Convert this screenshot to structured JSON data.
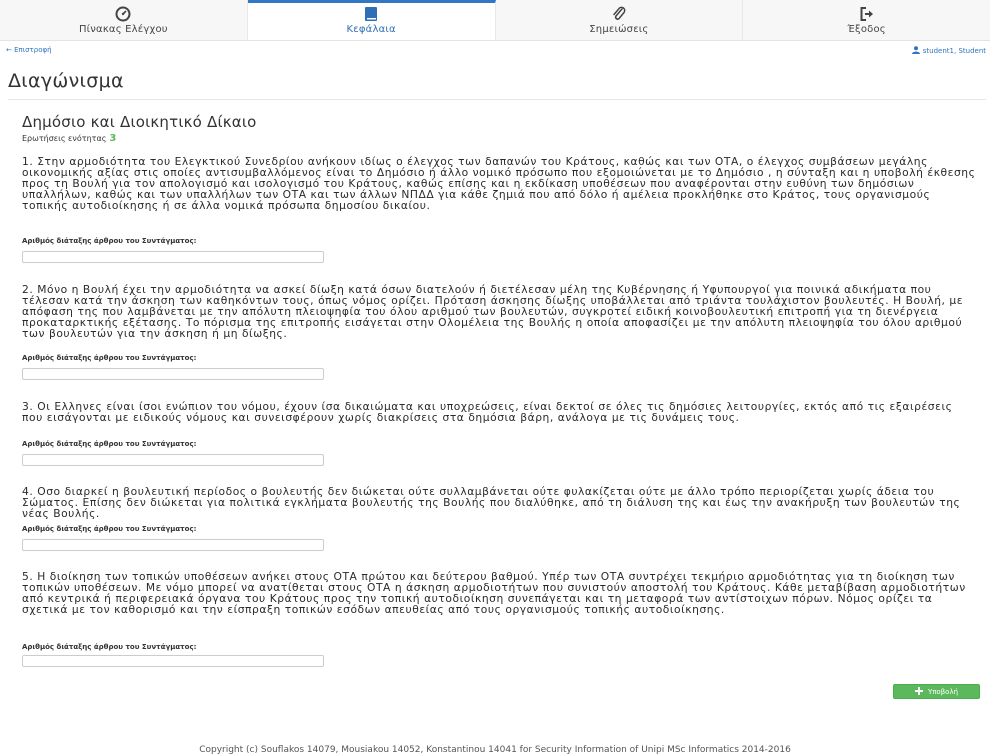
{
  "nav": {
    "tabs": [
      {
        "label": "Πίνακας Ελέγχου",
        "icon": "dashboard-icon"
      },
      {
        "label": "Κεφάλαια",
        "icon": "book-icon",
        "active": true
      },
      {
        "label": "Σημειώσεις",
        "icon": "paperclip-icon"
      },
      {
        "label": "Έξοδος",
        "icon": "sign-out-icon"
      }
    ]
  },
  "subbar": {
    "back_label": "← Επιστροφή",
    "user_label": "student1, Student"
  },
  "page": {
    "title": "Διαγώνισμα"
  },
  "section": {
    "title": "Δημόσιο και Διοικητικό Δίκαιο",
    "count_label": "Ερωτήσεις ενότητας",
    "count_value": "3"
  },
  "questions": [
    {
      "text": "1. Στην αρμοδιότητα του Ελεγκτικού Συνεδρίου ανήκουν ιδίως ο έλεγχος των δαπανών του Κράτους, καθώς και των ΟΤΑ, ο έλεγχος συμβάσεων μεγάλης οικονομικής αξίας στις οποίες αντισυμβαλλόμενος είναι το Δημόσιο ή άλλο νομικό πρόσωπο που εξομοιώνεται με το Δημόσιο , η σύνταξη και η υποβολή έκθεσης προς τη Βουλή για τον απολογισμό και ισολογισμό του Κράτους, καθώς επίσης και η εκδίκαση υποθέσεων που αναφέρονται στην ευθύνη των δημόσιων υπαλλήλων, καθώς και των υπαλλήλων των ΟΤΑ και των άλλων ΝΠΔΔ για κάθε ζημιά που από δόλο ή αμέλεια προκλήθηκε στο Κράτος, τους οργανισμούς τοπικής αυτοδιοίκησης ή σε άλλα νομικά πρόσωπα δημοσίου δικαίου.",
      "field_label": "Αριθμός διάταξης άρθρου του Συντάγματος:",
      "value": ""
    },
    {
      "text": "2. Μόνο η Βουλή έχει την αρμοδιότητα να ασκεί δίωξη κατά όσων διατελούν ή διετέλεσαν μέλη της Κυβέρνησης ή Υφυπουργοί για ποινικά αδικήματα που τέλεσαν κατά την άσκηση των καθηκόντων τους, όπως νόμος ορίζει. Πρόταση άσκησης δίωξης υποβάλλεται από τριάντα τουλάχιστον βουλευτές. Η Βουλή, με απόφαση της που λαμβάνεται με την απόλυτη πλειοψηφία του όλου αριθμού των βουλευτών, συγκροτεί ειδική κοινοβουλευτική επιτροπή για τη διενέργεια προκαταρκτικής εξέτασης. Το πόρισμα της επιτροπής εισάγεται στην Ολομέλεια της Βουλής η οποία αποφασίζει με την απόλυτη πλειοψηφία του όλου αριθμού των βουλευτών για την άσκηση ή μη δίωξης.",
      "field_label": "Αριθμός διάταξης άρθρου του Συντάγματος:",
      "value": ""
    },
    {
      "text": "3. Οι Ελληνες είναι ίσοι ενώπιον του νόμου, έχουν ίσα δικαιώματα και υποχρεώσεις, είναι δεκτοί σε όλες τις δημόσιες λειτουργίες, εκτός από τις εξαιρέσεις που εισάγονται με ειδικούς νόμους και συνεισφέρουν χωρίς διακρίσεις στα δημόσια βάρη, ανάλογα με τις δυνάμεις τους.",
      "field_label": "Αριθμός διάταξης άρθρου του Συντάγματος:",
      "value": ""
    },
    {
      "text": "4. Οσο διαρκεί η βουλευτική περίοδος ο βουλευτής δεν διώκεται ούτε συλλαμβάνεται ούτε φυλακίζεται ούτε με άλλο τρόπο περιορίζεται χωρίς άδεια του Σώματος. Επίσης δεν διώκεται για πολιτικά εγκλήματα βουλευτής της Βουλής που διαλύθηκε, από τη διάλυση της και έως την ανακήρυξη των βουλευτών της νέας Βουλής.",
      "field_label": "Αριθμός διάταξης άρθρου του Συντάγματος:",
      "value": ""
    },
    {
      "text": "5. Η διοίκηση των τοπικών υποθέσεων ανήκει στους ΟΤΑ πρώτου και δεύτερου βαθμού. Υπέρ των ΟΤΑ συντρέχει τεκμήριο αρμοδιότητας για τη διοίκηση των τοπικών υποθέσεων. Με νόμο μπορεί να ανατίθεται στους ΟΤΑ η άσκηση αρμοδιοτήτων που συνιστούν αποστολή του Κράτους. Κάθε μεταβίβαση αρμοδιοτήτων από κεντρικά ή περιφερειακά όργανα του Κράτους προς την τοπική αυτοδιοίκηση συνεπάγεται και τη μεταφορά των αντίστοιχων πόρων. Νόμος ορίζει τα σχετικά με τον καθορισμό και την είσπραξη τοπικών εσόδων απευθείας από τους οργανισμούς τοπικής αυτοδιοίκησης.",
      "field_label": "Αριθμός διάταξης άρθρου του Συντάγματος:",
      "value": ""
    }
  ],
  "submit_label": "Υποβολή",
  "footer": "Copyright (c) Souflakos 14079, Mousiakou 14052, Konstantinou 14041 for Security Information of Unipi MSc Informatics 2014-2016",
  "colors": {
    "accent": "#3277c3",
    "success": "#5cb85c",
    "link": "#2f74c0"
  }
}
